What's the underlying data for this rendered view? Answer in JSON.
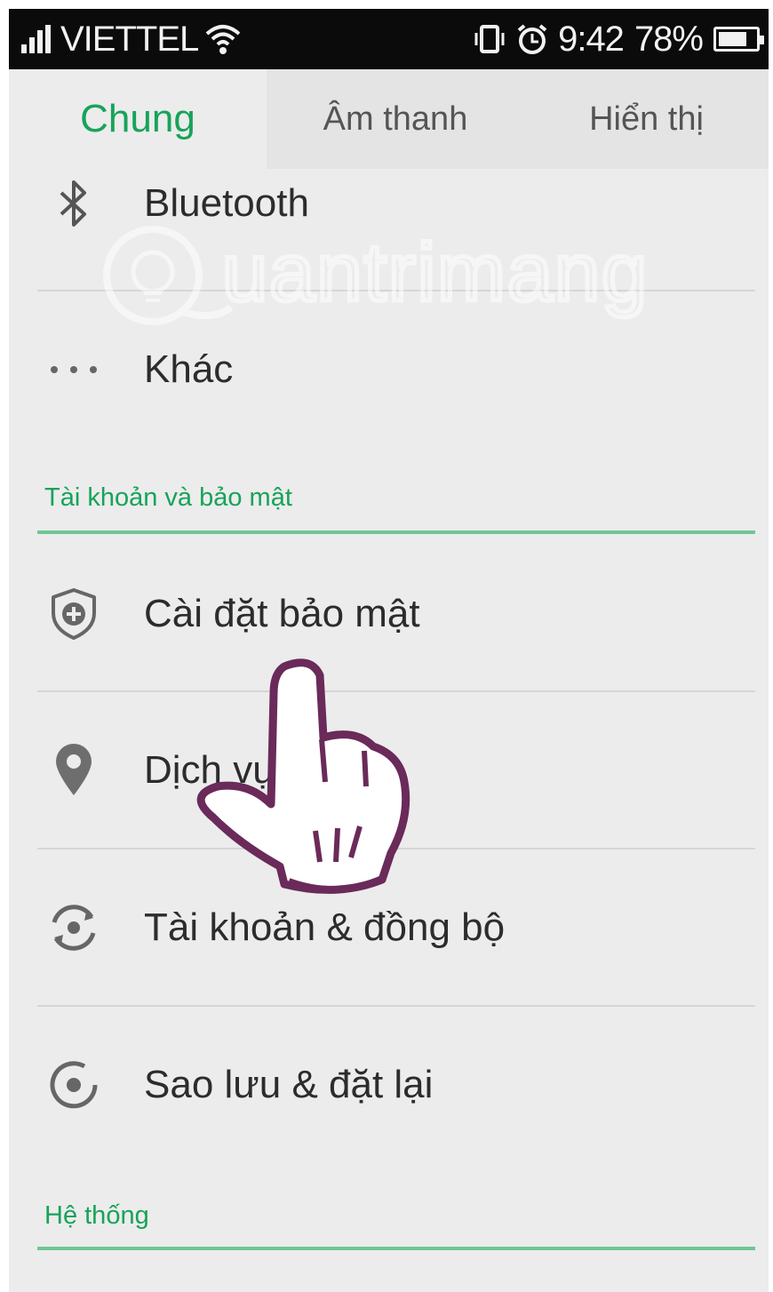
{
  "status_bar": {
    "carrier": "VIETTEL",
    "time": "9:42",
    "battery": "78%",
    "battery_level": 0.78
  },
  "tabs": [
    {
      "label": "Chung",
      "active": true
    },
    {
      "label": "Âm thanh",
      "active": false
    },
    {
      "label": "Hiển thị",
      "active": false
    }
  ],
  "list": {
    "bluetooth": {
      "label": "Bluetooth",
      "icon": "bluetooth-icon"
    },
    "other": {
      "label": "Khác",
      "icon": "more-dots-icon"
    },
    "section_account": "Tài khoản và bảo mật",
    "security": {
      "label": "Cài đặt bảo mật",
      "icon": "shield-plus-icon"
    },
    "location": {
      "label": "Dịch vụ",
      "icon": "location-pin-icon"
    },
    "accounts_sync": {
      "label": "Tài khoản & đồng bộ",
      "icon": "sync-icon"
    },
    "backup_reset": {
      "label": "Sao lưu & đặt lại",
      "icon": "backup-reset-icon"
    },
    "section_system": "Hệ thống"
  },
  "watermark_text": "Quantrimang",
  "colors": {
    "accent": "#17a35a",
    "status_bar_bg": "#0b0b0b",
    "list_bg": "#ececec",
    "hand_outline": "#6a2a5a"
  }
}
